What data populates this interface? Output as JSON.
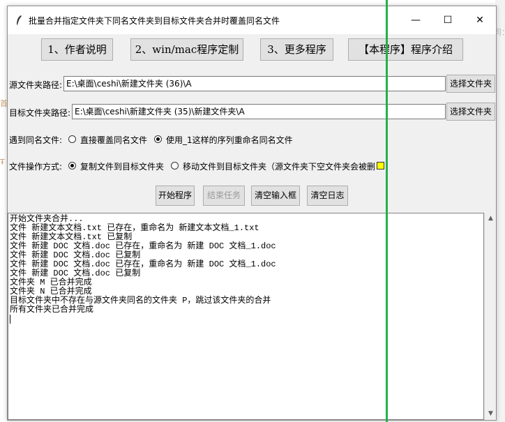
{
  "window": {
    "title": "批量合并指定文件夹下同名文件夹到目标文件夹合并时覆盖同名文件",
    "controls": {
      "minimize": "—",
      "maximize": "☐",
      "close": "✕"
    }
  },
  "background": {
    "right_fragment": "同：",
    "left_fragments": [
      "首",
      "Ŧ"
    ]
  },
  "top_buttons": [
    "1、作者说明",
    "2、win/mac程序定制",
    "3、更多程序",
    "【本程序】程序介绍"
  ],
  "source": {
    "label": "源文件夹路径:",
    "value": "E:\\桌面\\ceshi\\新建文件夹 (36)\\A",
    "button": "选择文件夹"
  },
  "target": {
    "label": "目标文件夹路径:",
    "value": "E:\\桌面\\ceshi\\新建文件夹 (35)\\新建文件夹\\A",
    "button": "选择文件夹"
  },
  "duplicate": {
    "label": "遇到同名文件:",
    "options": [
      {
        "label": "直接覆盖同名文件",
        "selected": false
      },
      {
        "label": "使用_1这样的序列重命名同名文件",
        "selected": true
      }
    ]
  },
  "operation": {
    "label": "文件操作方式:",
    "options": [
      {
        "label": "复制文件到目标文件夹",
        "selected": true
      },
      {
        "label": "移动文件到目标文件夹（源文件夹下空文件夹会被删",
        "selected": false
      }
    ]
  },
  "actions": {
    "start": "开始程序",
    "stop": "结束任务",
    "clear_input": "清空输入框",
    "clear_log": "清空日志"
  },
  "log": [
    "开始文件夹合并...",
    "文件 新建文本文档.txt 已存在，重命名为 新建文本文档_1.txt",
    "文件 新建文本文档.txt 已复制",
    "文件 新建 DOC 文档.doc 已存在，重命名为 新建 DOC 文档_1.doc",
    "文件 新建 DOC 文档.doc 已复制",
    "文件 新建 DOC 文档.doc 已存在，重命名为 新建 DOC 文档_1.doc",
    "文件 新建 DOC 文档.doc 已复制",
    "文件夹 M 已合并完成",
    "文件夹 N 已合并完成",
    "目标文件夹中不存在与源文件夹同名的文件夹 P，跳过该文件夹的合并",
    "所有文件夹已合并完成"
  ],
  "colors": {
    "overlay_line": "#22b14c",
    "partial_checkbox": "#ffff00"
  }
}
